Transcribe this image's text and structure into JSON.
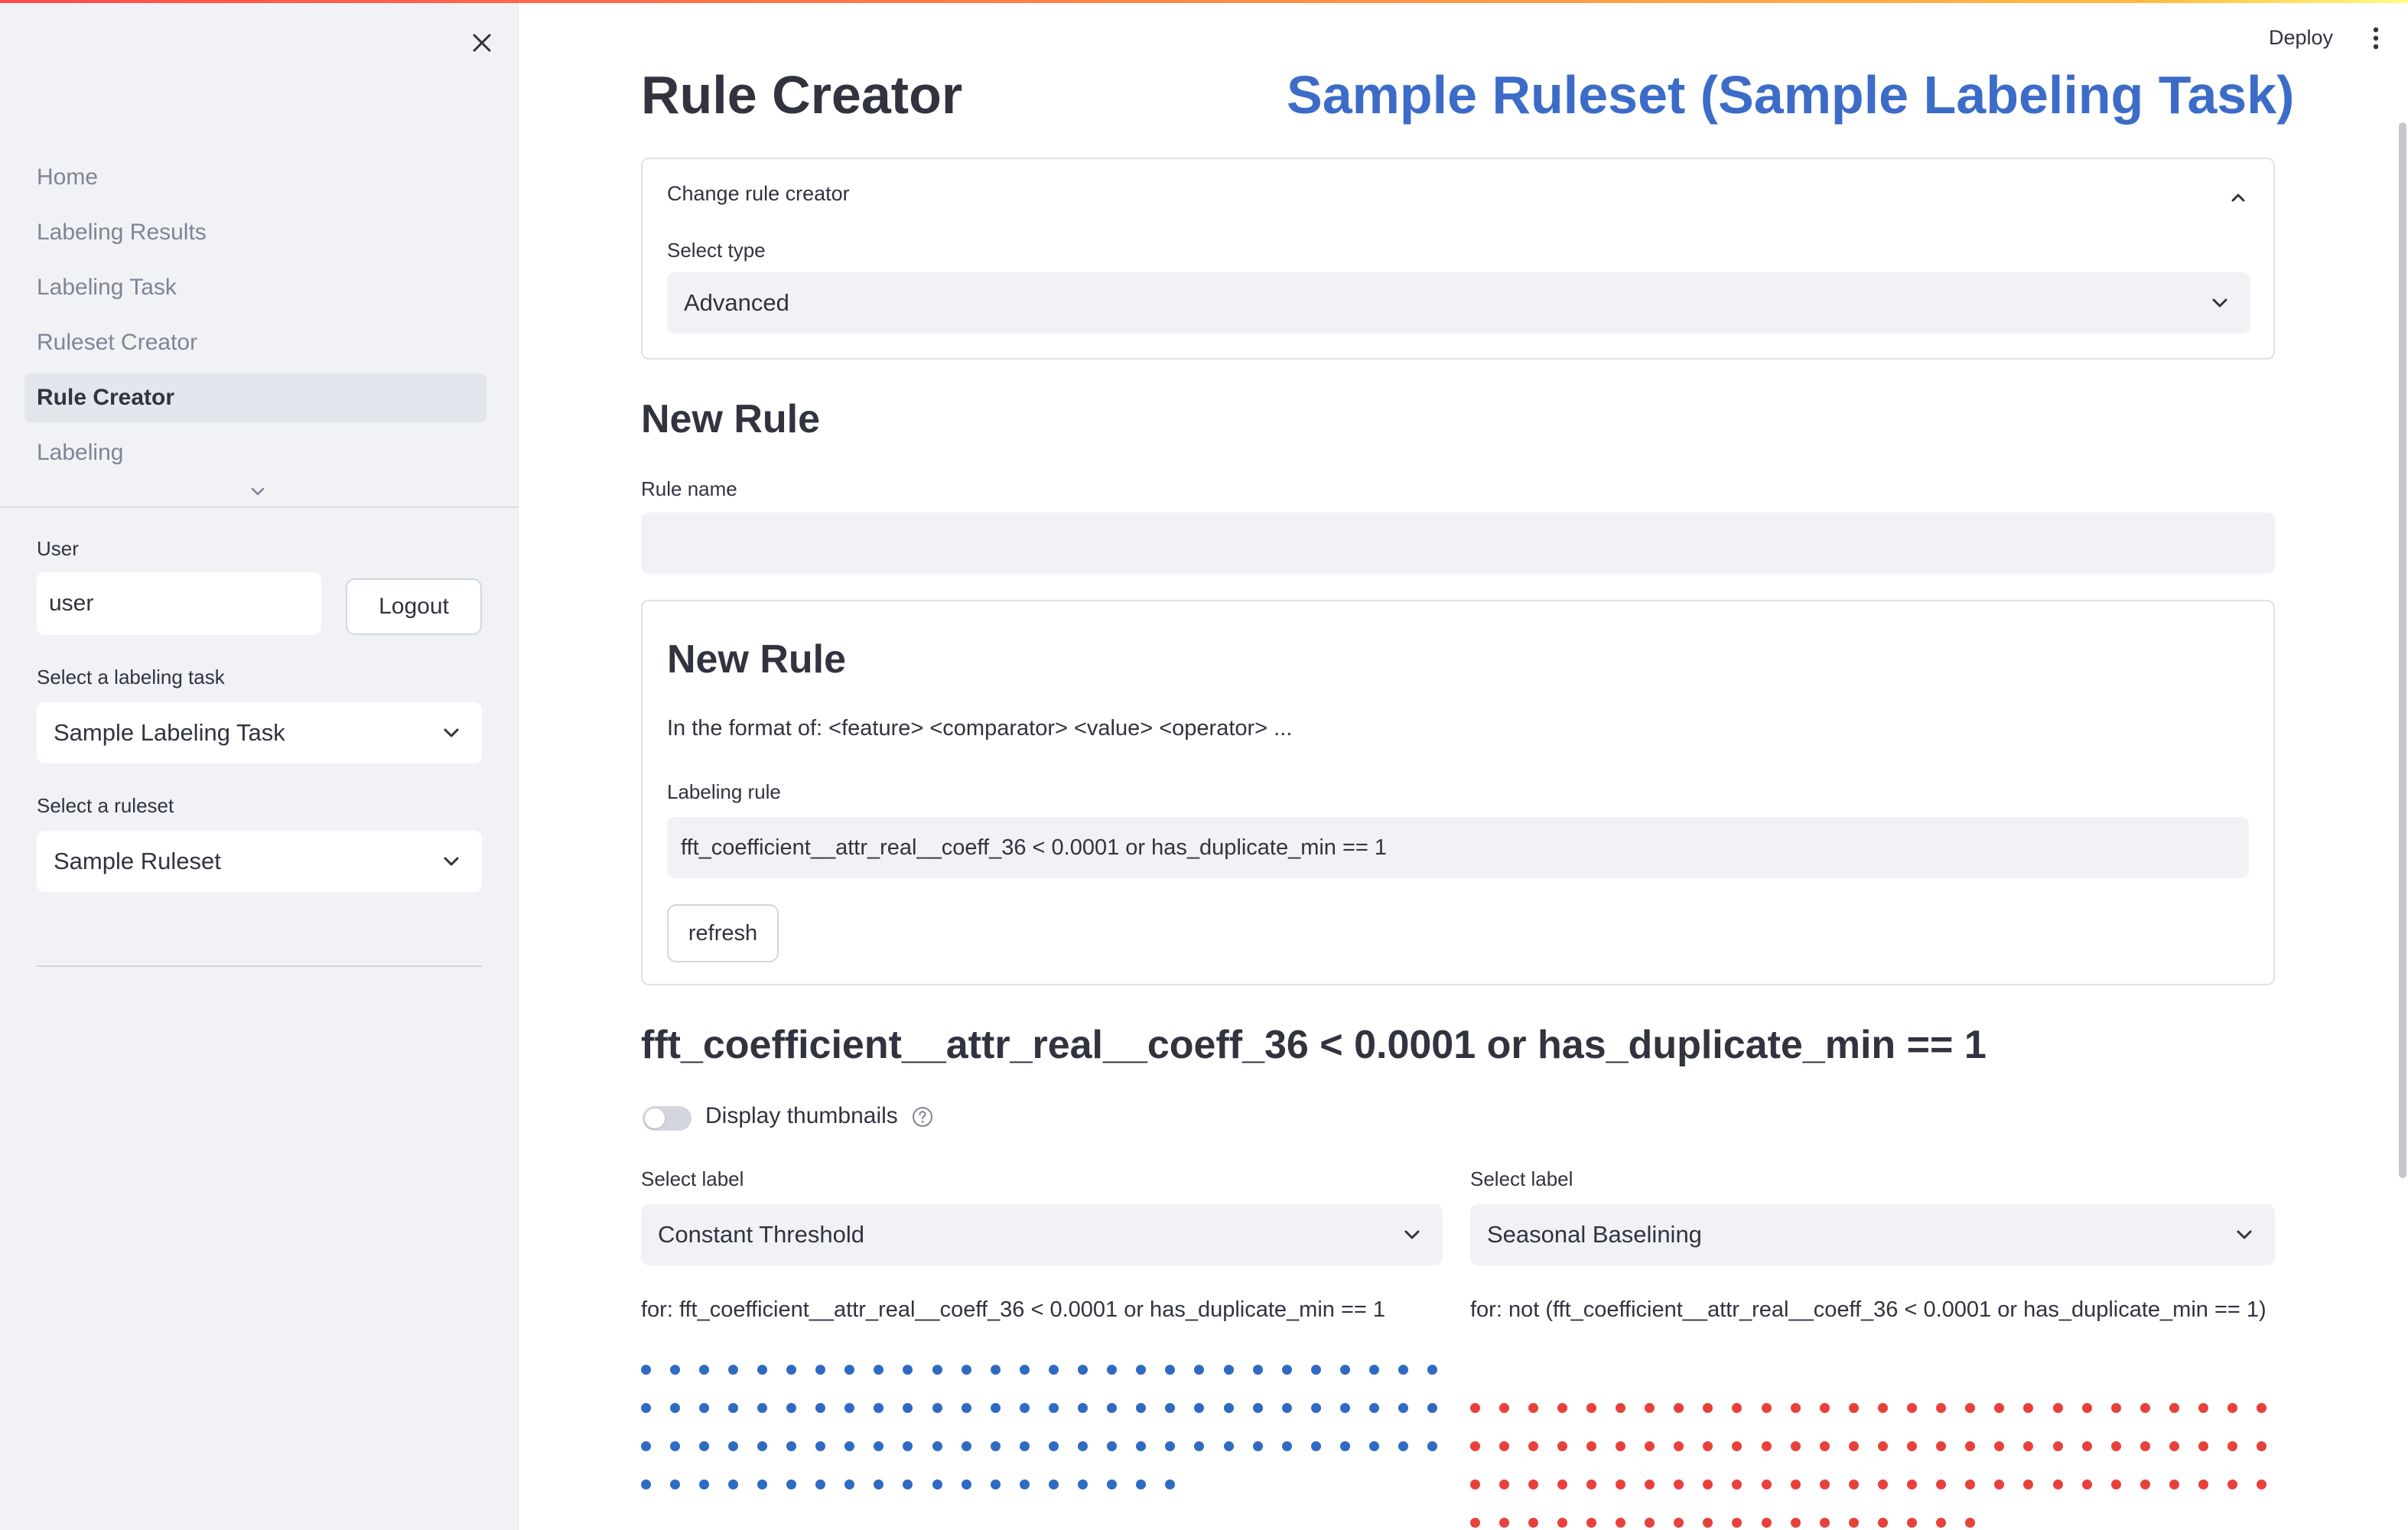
{
  "sidebar": {
    "nav_items": [
      {
        "label": "Home",
        "active": false
      },
      {
        "label": "Labeling Results",
        "active": false
      },
      {
        "label": "Labeling Task",
        "active": false
      },
      {
        "label": "Ruleset Creator",
        "active": false
      },
      {
        "label": "Rule Creator",
        "active": true
      },
      {
        "label": "Labeling",
        "active": false
      }
    ],
    "user_label": "User",
    "user_value": "user",
    "logout_label": "Logout",
    "labeling_task_label": "Select a labeling task",
    "labeling_task_value": "Sample Labeling Task",
    "ruleset_label": "Select a ruleset",
    "ruleset_value": "Sample Ruleset"
  },
  "header": {
    "deploy_label": "Deploy"
  },
  "main": {
    "page_title": "Rule Creator",
    "ruleset_title": "Sample Ruleset (Sample Labeling Task)",
    "expander": {
      "header": "Change rule creator",
      "select_type_label": "Select type",
      "select_type_value": "Advanced"
    },
    "new_rule_heading": "New Rule",
    "rule_name_label": "Rule name",
    "rule_name_value": "",
    "form": {
      "heading": "New Rule",
      "format_text": "In the format of: <feature> <comparator> <value> <operator> ...",
      "labeling_rule_label": "Labeling rule",
      "labeling_rule_value": "fft_coefficient__attr_real__coeff_36 < 0.0001 or has_duplicate_min == 1",
      "refresh_label": "refresh"
    },
    "rule_heading": "fft_coefficient__attr_real__coeff_36 < 0.0001 or has_duplicate_min == 1",
    "display_thumbnails_label": "Display thumbnails",
    "display_thumbnails_on": false,
    "left_column": {
      "select_label": "Select label",
      "select_value": "Constant Threshold",
      "for_text": "for: fft_coefficient__attr_real__coeff_36 < 0.0001 or has_duplicate_min == 1",
      "dot_color": "#2f6ac4",
      "dot_rows": [
        28,
        28,
        28,
        19
      ]
    },
    "right_column": {
      "select_label": "Select label",
      "select_value": "Seasonal Baselining",
      "for_text": "for: not (fft_coefficient__attr_real__coeff_36 < 0.0001 or has_duplicate_min == 1)",
      "dot_color": "#e8413b",
      "dot_rows": [
        28,
        28,
        28,
        18
      ]
    }
  },
  "colors": {
    "accent": "#3c6cc8",
    "sidebar_bg": "#f0f2f6",
    "input_bg": "#f0f2f6",
    "text": "#31333f"
  },
  "icons": {
    "close": "close-icon",
    "chevron_down": "chevron-down-icon",
    "chevron_up": "chevron-up-icon",
    "kebab": "kebab-menu-icon",
    "help": "help-icon"
  }
}
